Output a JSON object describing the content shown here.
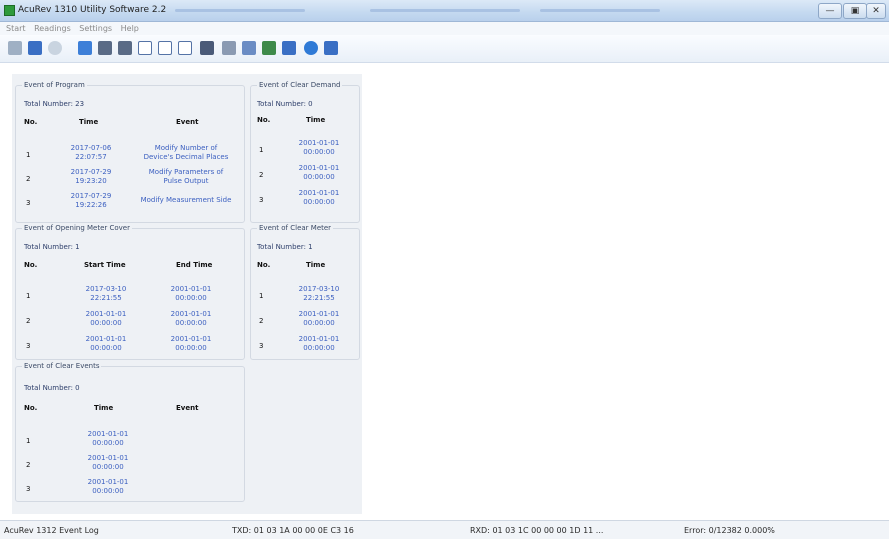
{
  "window": {
    "title": "AcuRev 1310 Utility Software 2.2",
    "min_label": "—",
    "max_label": "▣",
    "close_label": "✕"
  },
  "menu": [
    "Start",
    "Readings",
    "Settings",
    "Help"
  ],
  "toolbar": {
    "icons": [
      "connect-icon",
      "disconnect-icon",
      "settings-icon",
      "monitor-icon",
      "meter-icon",
      "meter2-icon",
      "chart-icon",
      "table-icon",
      "calendar-icon",
      "export-icon",
      "tools-icon",
      "log-icon",
      "event-icon",
      "report-icon",
      "help-icon",
      "exit-icon"
    ]
  },
  "program_events": {
    "title": "Event of Program",
    "total": "Total Number: 23",
    "headers": [
      "No.",
      "Time",
      "Event"
    ],
    "rows": [
      {
        "no": "1",
        "time": "2017-07-06\n22:07:57",
        "event": "Modify Number of\nDevice's Decimal Places"
      },
      {
        "no": "2",
        "time": "2017-07-29\n19:23:20",
        "event": "Modify Parameters of\nPulse Output"
      },
      {
        "no": "3",
        "time": "2017-07-29\n19:22:26",
        "event": "Modify Measurement Side"
      }
    ]
  },
  "clear_demand": {
    "title": "Event of Clear Demand",
    "total": "Total Number: 0",
    "headers": [
      "No.",
      "Time"
    ],
    "rows": [
      {
        "no": "1",
        "time": "2001-01-01\n00:00:00"
      },
      {
        "no": "2",
        "time": "2001-01-01\n00:00:00"
      },
      {
        "no": "3",
        "time": "2001-01-01\n00:00:00"
      }
    ]
  },
  "meter_cover": {
    "title": "Event of Opening Meter Cover",
    "total": "Total Number: 1",
    "headers": [
      "No.",
      "Start Time",
      "End Time"
    ],
    "rows": [
      {
        "no": "1",
        "start": "2017-03-10\n22:21:55",
        "end": "2001-01-01\n00:00:00"
      },
      {
        "no": "2",
        "start": "2001-01-01\n00:00:00",
        "end": "2001-01-01\n00:00:00"
      },
      {
        "no": "3",
        "start": "2001-01-01\n00:00:00",
        "end": "2001-01-01\n00:00:00"
      }
    ]
  },
  "clear_meter": {
    "title": "Event of Clear Meter",
    "total": "Total Number: 1",
    "headers": [
      "No.",
      "Time"
    ],
    "rows": [
      {
        "no": "1",
        "time": "2017-03-10\n22:21:55"
      },
      {
        "no": "2",
        "time": "2001-01-01\n00:00:00"
      },
      {
        "no": "3",
        "time": "2001-01-01\n00:00:00"
      }
    ]
  },
  "clear_events": {
    "title": "Event of Clear Events",
    "total": "Total Number: 0",
    "headers": [
      "No.",
      "Time",
      "Event"
    ],
    "rows": [
      {
        "no": "1",
        "time": "2001-01-01\n00:00:00"
      },
      {
        "no": "2",
        "time": "2001-01-01\n00:00:00"
      },
      {
        "no": "3",
        "time": "2001-01-01\n00:00:00"
      }
    ]
  },
  "status": {
    "left": "AcuRev 1312 Event Log",
    "txd": "TXD: 01 03 1A 00 00 0E C3 16",
    "rxd": "RXD: 01 03 1C 00 00 00 1D 11 ...",
    "error": "Error: 0/12382  0.000%"
  },
  "colors": {
    "link_text": "#3b5fc0",
    "panel_bg": "#eef1f5",
    "titlebar": "#c4d9f0"
  }
}
